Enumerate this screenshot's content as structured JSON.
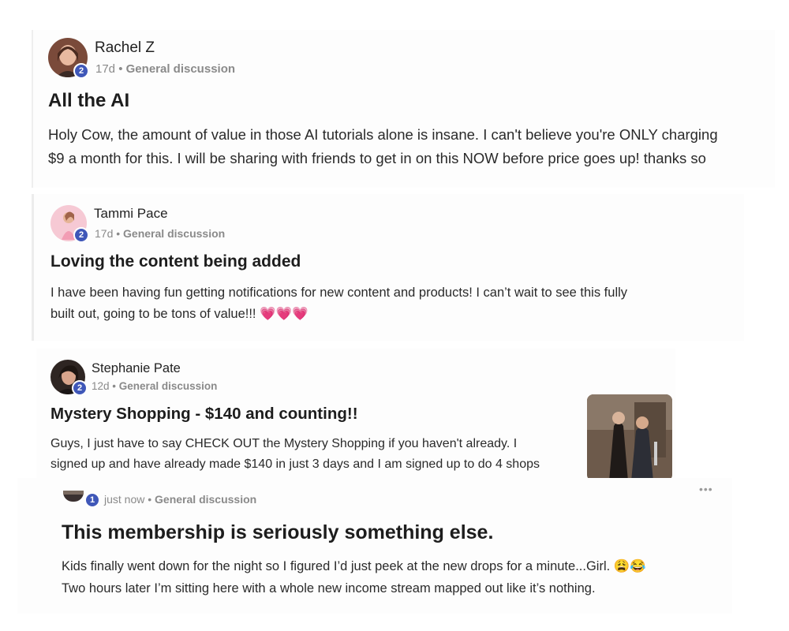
{
  "posts": [
    {
      "author": "Rachel Z",
      "level": "2",
      "time": "17d",
      "separator": "•",
      "category": "General discussion",
      "title": "All the AI",
      "body_line1": "Holy Cow, the amount of value in those AI tutorials alone is insane. I can't believe you're ONLY charging",
      "body_line2": "$9 a month for this. I will be sharing with friends to get in on this NOW before price goes up! thanks so"
    },
    {
      "author": "Tammi Pace",
      "level": "2",
      "time": "17d",
      "separator": "•",
      "category": "General discussion",
      "title": "Loving the content being added",
      "body_line1": "I have been having fun getting notifications for new content and products! I can’t wait to see this fully",
      "body_line2": "built out, going to be tons of value!!! 💗💗💗"
    },
    {
      "author": "Stephanie Pate",
      "level": "2",
      "time": "12d",
      "separator": "•",
      "category": "General discussion",
      "title": "Mystery Shopping - $140 and counting!!",
      "body_line1": "Guys, I just have to say CHECK OUT the Mystery Shopping if you haven't already. I",
      "body_line2": "signed up and have already made $140 in just 3 days and I am signed up to do 4 shops",
      "thumbnail": "mystery-shopping-photo"
    },
    {
      "level": "1",
      "time": "just now",
      "separator": "•",
      "category": "General discussion",
      "title": "This membership is seriously something else.",
      "body_line1": "Kids finally went down for the night so I figured I’d just peek at the new drops for a minute...Girl. 😩😂",
      "body_line2": "Two hours later I’m sitting here with a whole new income stream mapped out like it’s nothing.",
      "more_label": "•••"
    }
  ],
  "colors": {
    "badge": "#3f57b8",
    "meta": "#8a8a8a",
    "title": "#1d1d1d"
  }
}
